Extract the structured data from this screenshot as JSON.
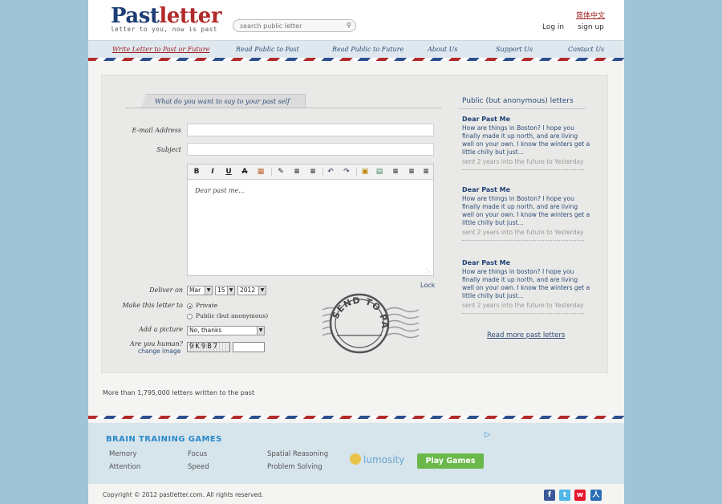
{
  "header": {
    "logo_past": "Past",
    "logo_letter": "letter",
    "tagline": "letter to you, now is past",
    "search_placeholder": "search public letter",
    "language_link": "简体中文",
    "login": "Log in",
    "signup": "sign up"
  },
  "nav": [
    {
      "label": "Write Letter to Past or Future",
      "active": true
    },
    {
      "label": "Read Public to Past",
      "active": false
    },
    {
      "label": "Read Public to Future",
      "active": false
    },
    {
      "label": "About Us",
      "active": false
    },
    {
      "label": "Support Us",
      "active": false
    },
    {
      "label": "Contact Us",
      "active": false
    }
  ],
  "form": {
    "tab_title": "What do you want to say to your past self",
    "email_label": "E-mail Address",
    "subject_label": "Subject",
    "editor_placeholder": "Dear past me...",
    "lock_link": "Lock",
    "deliver_label": "Deliver on",
    "deliver_month": "Mar",
    "deliver_day": "15",
    "deliver_year": "2012",
    "make_letter_label": "Make this letter to",
    "option_private": "Private",
    "option_public": "Public (but anonymous)",
    "selected_option": "private",
    "picture_label": "Add a picture",
    "picture_value": "No, thanks",
    "human_label": "Are you human?",
    "change_image": "change image",
    "captcha_text": "9K9B7",
    "stamp_text": "SEND TO PAST"
  },
  "toolbar_icons": [
    "bold-icon",
    "italic-icon",
    "underline-icon",
    "strikethrough-icon",
    "font-color-icon",
    "highlight-color-icon",
    "numbered-list-icon",
    "bulleted-list-icon",
    "undo-icon",
    "redo-icon",
    "insert-image-icon",
    "insert-media-icon",
    "align-center-icon",
    "align-left-icon",
    "align-right-icon"
  ],
  "sidebar": {
    "title": "Public (but anonymous) letters",
    "letters": [
      {
        "heading": "Dear Past Me",
        "body": "How are things in Boston? I hope you finally made it up north, and are living well on your own. I know the winters get a little chilly but just...",
        "sent": "sent 2 years into the future to Yesterday"
      },
      {
        "heading": "Dear Past Me",
        "body": "How are things in Boston? I hope you finally made it up north, and are living well on your own. I know the winters get a little chilly but just...",
        "sent": "sent 2 years into the future to Yesterday"
      },
      {
        "heading": "Dear Past Me",
        "body": "How are things in boston? I hope you finally made it up north, and are living well on your own. I know the winters get a little chilly but just...",
        "sent": "sent 2 years into the future to Yesterday"
      }
    ],
    "read_more": "Read more past letters"
  },
  "footer_note": "More than 1,795,000 letters written to the past",
  "ad": {
    "title": "BRAIN TRAINING GAMES",
    "links": [
      "Memory",
      "Focus",
      "Spatial Reasoning",
      "Attention",
      "Speed",
      "Problem Solving"
    ],
    "brand": "lumosity",
    "cta": "Play Games",
    "adchoices": "▷"
  },
  "footer": {
    "copyright": "Copyright © 2012 pastletter.com. All rights reserved.",
    "social": [
      "facebook-icon",
      "twitter-icon",
      "weibo-icon",
      "renren-icon"
    ]
  }
}
